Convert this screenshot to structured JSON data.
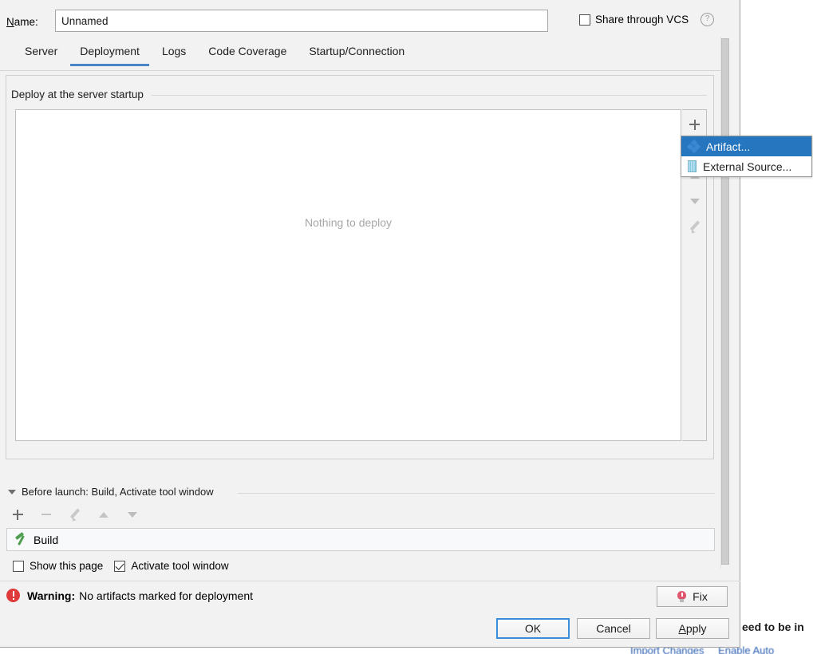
{
  "dialog": {
    "name_label": "Name:",
    "name_label_mnemonic": "N",
    "name_value": "Unnamed",
    "share_vcs_label": "Share through VCS",
    "share_vcs_checked": false,
    "help_icon": "help-icon",
    "tabs": [
      {
        "label": "Server",
        "active": false
      },
      {
        "label": "Deployment",
        "active": true
      },
      {
        "label": "Logs",
        "active": false
      },
      {
        "label": "Code Coverage",
        "active": false
      },
      {
        "label": "Startup/Connection",
        "active": false
      }
    ],
    "accent_color": "#4a86c5"
  },
  "deploy_group": {
    "title": "Deploy at the server startup",
    "empty_text": "Nothing to deploy",
    "toolbar": [
      {
        "name": "add-button",
        "icon": "plus-icon",
        "enabled": true
      },
      {
        "name": "remove-button",
        "icon": "minus-icon",
        "enabled": false
      },
      {
        "name": "move-up-button",
        "icon": "arrow-up-icon",
        "enabled": false
      },
      {
        "name": "move-down-button",
        "icon": "arrow-down-icon",
        "enabled": false
      },
      {
        "name": "edit-button",
        "icon": "pencil-icon",
        "enabled": false
      }
    ]
  },
  "popup_menu": {
    "items": [
      {
        "label": "Artifact...",
        "icon": "artifact-icon",
        "selected": true
      },
      {
        "label": "External Source...",
        "icon": "external-source-icon",
        "selected": false
      }
    ],
    "highlight_color": "#2675bf"
  },
  "before_launch": {
    "header": "Before launch: Build, Activate tool window",
    "header_mnemonic": "B",
    "toolbar": [
      {
        "name": "add-task-button",
        "icon": "plus-icon",
        "enabled": true
      },
      {
        "name": "remove-task-button",
        "icon": "minus-icon",
        "enabled": false
      },
      {
        "name": "edit-task-button",
        "icon": "pencil-icon",
        "enabled": false
      },
      {
        "name": "move-task-up-button",
        "icon": "arrow-up-icon",
        "enabled": false
      },
      {
        "name": "move-task-down-button",
        "icon": "arrow-down-icon",
        "enabled": false
      }
    ],
    "tasks": [
      {
        "label": "Build",
        "icon": "hammer-icon"
      }
    ],
    "show_this_page_label": "Show this page",
    "show_this_page_checked": false,
    "activate_tool_window_label": "Activate tool window",
    "activate_tool_window_checked": true
  },
  "status": {
    "warning_prefix": "Warning:",
    "warning_message": "No artifacts marked for deployment",
    "warning_color": "#df3b3b",
    "fix_label": "Fix",
    "fix_icon": "bulb-icon"
  },
  "buttons": {
    "ok": "OK",
    "cancel": "Cancel",
    "apply": "Apply",
    "apply_mnemonic": "A",
    "ok_focus_color": "#3a8ddb"
  },
  "background": {
    "clipped_text": "eed to be in",
    "import_changes_link": "Import Changes",
    "enable_auto_link": "Enable Auto",
    "link_color": "#2a5db0",
    "notification_color": "#fbf8e3"
  }
}
